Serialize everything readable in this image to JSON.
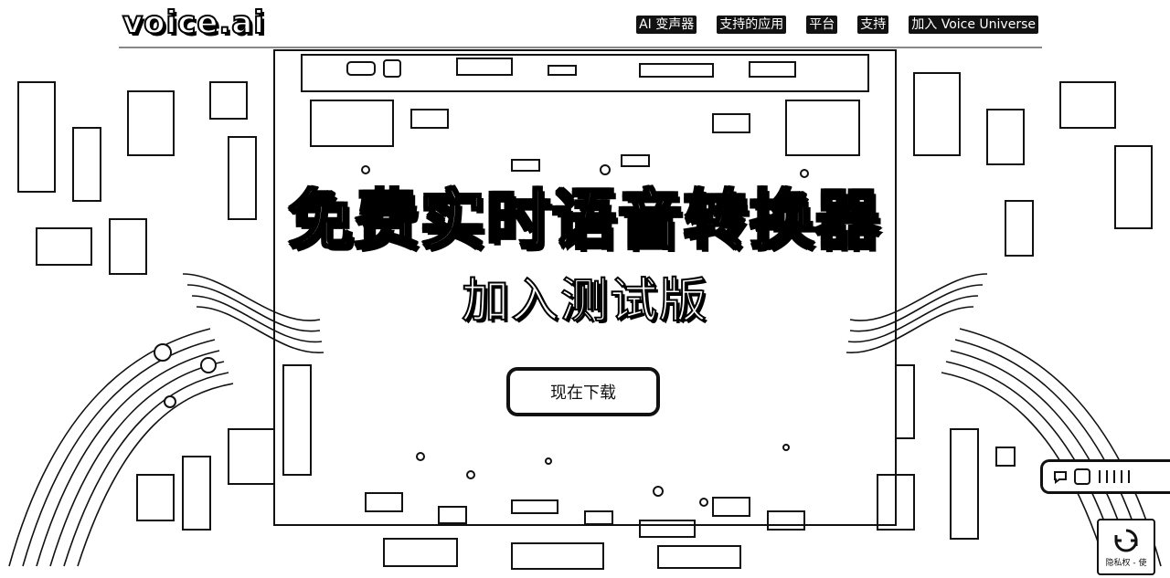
{
  "brand": {
    "logo_text": "voice.ai"
  },
  "nav": {
    "items": [
      {
        "label": "AI 变声器"
      },
      {
        "label": "支持的应用"
      },
      {
        "label": "平台"
      },
      {
        "label": "支持"
      },
      {
        "label": "加入 Voice Universe"
      }
    ]
  },
  "hero": {
    "title": "免费实时语音转换器",
    "subtitle": "加入测试版",
    "cta_label": "现在下载"
  },
  "recaptcha": {
    "text": "隐私权 - 使"
  },
  "colors": {
    "ink": "#111111",
    "paper": "#ffffff"
  }
}
